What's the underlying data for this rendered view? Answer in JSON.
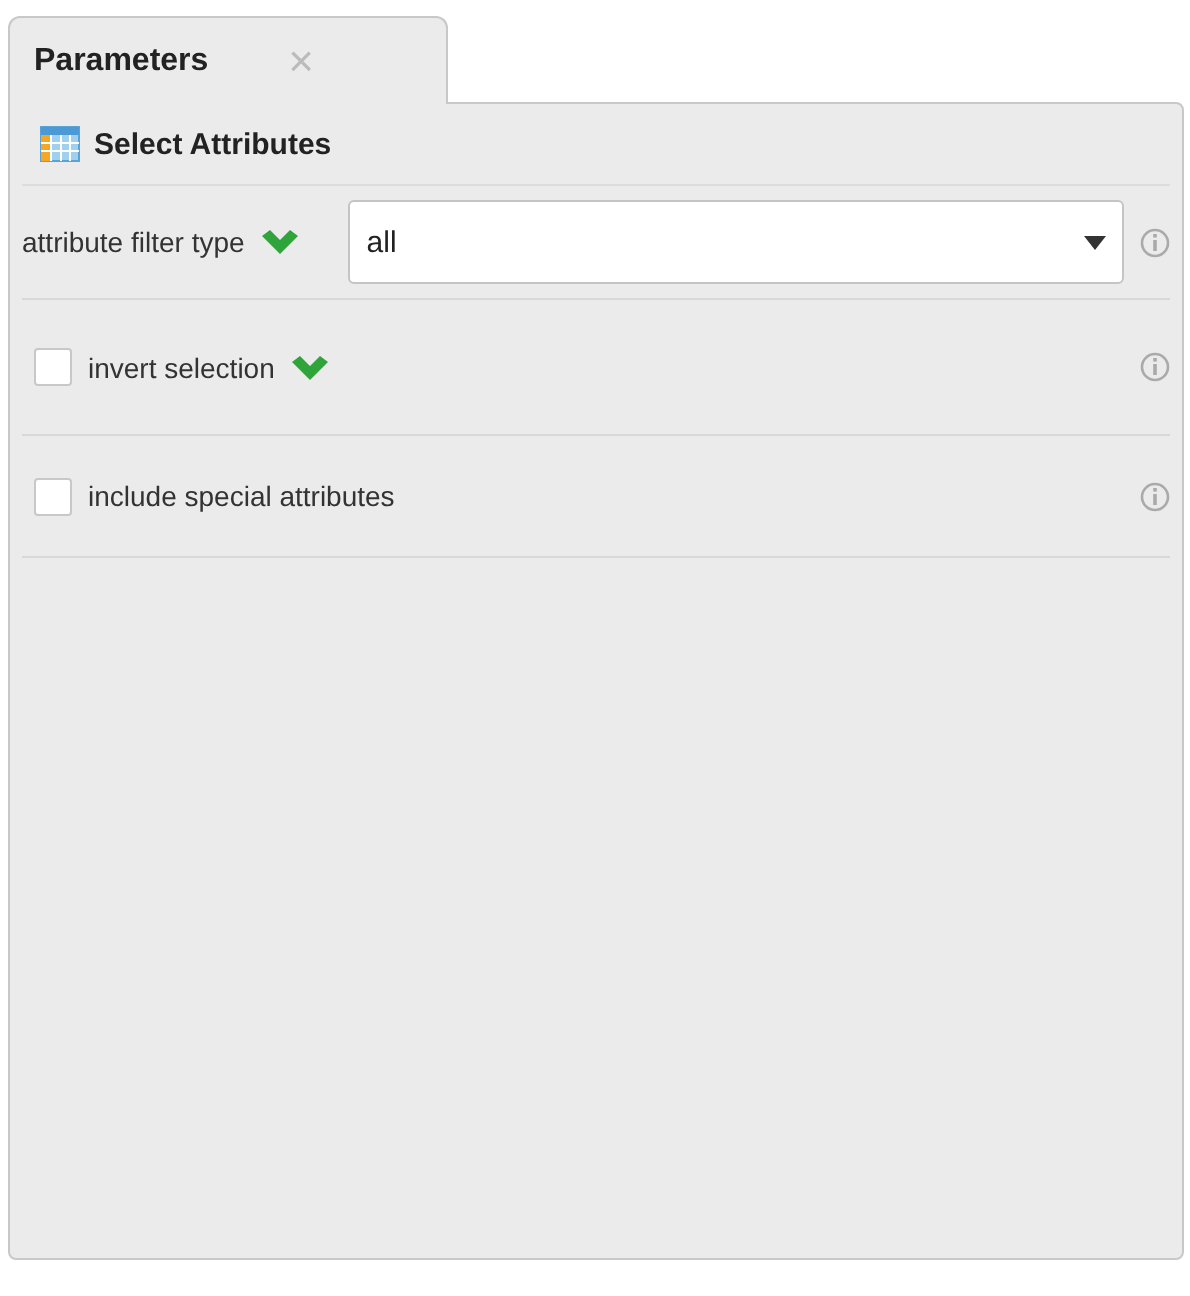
{
  "tab": {
    "label": "Parameters",
    "close": "×",
    "selected": true
  },
  "section": {
    "title": "Select Attributes"
  },
  "parameters": [
    {
      "kind": "select",
      "label": "attribute filter type",
      "chevron": true,
      "value": "all"
    },
    {
      "kind": "checkbox",
      "label": "invert selection",
      "chevron": true,
      "checked": false
    },
    {
      "kind": "checkbox",
      "label": "include special attributes",
      "chevron": false,
      "checked": false
    }
  ]
}
